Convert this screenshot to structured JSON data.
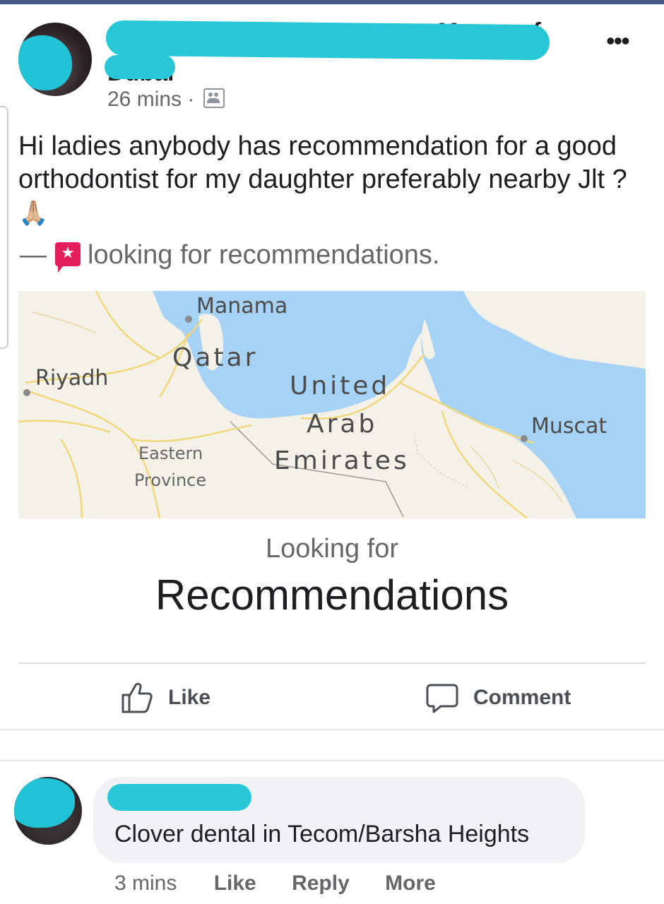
{
  "post": {
    "author_partial": "Mums of",
    "author_partial_line2": "Dubai",
    "timestamp": "26 mins ·",
    "privacy_icon": "friends-icon",
    "more_label": "•••",
    "text": "Hi ladies anybody has recommendation for a good orthodontist for my daughter preferably nearby Jlt ?",
    "emoji": "🙏🏼",
    "activity_dash": "—",
    "activity_icon": "star-speech-bubble-icon",
    "activity_text": "looking for recommendations."
  },
  "map": {
    "labels": {
      "manama": "Manama",
      "qatar": "Qatar",
      "riyadh": "Riyadh",
      "uae_1": "United",
      "uae_2": "Arab",
      "uae_3": "Emirates",
      "muscat": "Muscat",
      "eastern_1": "Eastern",
      "eastern_2": "Province"
    },
    "colors": {
      "water": "#a6d3f5",
      "land": "#f4f1e8",
      "roads": "#f2d77a"
    }
  },
  "card": {
    "kicker": "Looking for",
    "title": "Recommendations"
  },
  "actions": {
    "like": "Like",
    "comment": "Comment"
  },
  "comment": {
    "text": "Clover dental in Tecom/Barsha Heights",
    "time": "3 mins",
    "like": "Like",
    "reply": "Reply",
    "more": "More"
  },
  "colors": {
    "redaction": "#27c7d8",
    "activity_icon": "#e41e5a",
    "secondary_text": "#65676b"
  }
}
